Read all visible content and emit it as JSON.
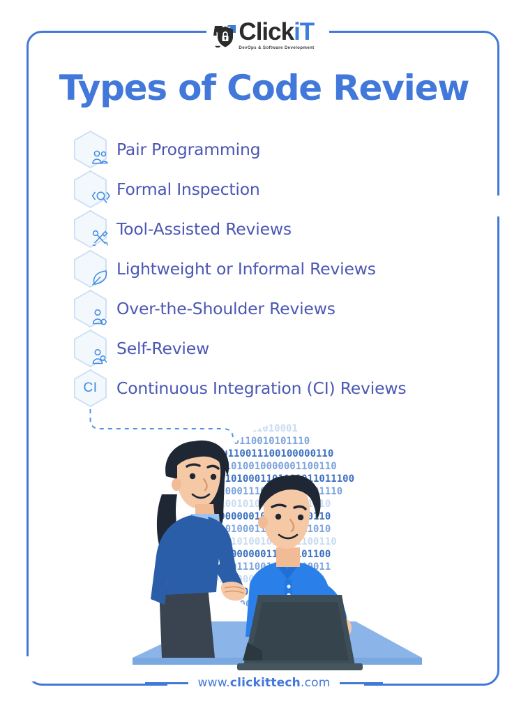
{
  "brand": {
    "logo_name": "ClickIT",
    "logo_name_plain": "Click",
    "logo_name_accent": "iT",
    "logo_tagline": "DevOps & Software Development",
    "logo_icon": "shield-lock-arrows-icon",
    "accent_color": "#4178da",
    "logo_dark_color": "#2b2b2b"
  },
  "header": {
    "title": "Types of Code Review"
  },
  "list": {
    "items": [
      {
        "label": "Pair Programming",
        "icon": "people-group-icon"
      },
      {
        "label": "Formal Inspection",
        "icon": "magnifier-brackets-icon"
      },
      {
        "label": "Tool-Assisted Reviews",
        "icon": "wrench-screwdriver-icon"
      },
      {
        "label": "Lightweight or Informal Reviews",
        "icon": "feather-pen-icon"
      },
      {
        "label": "Over-the-Shoulder Reviews",
        "icon": "person-over-shoulder-icon"
      },
      {
        "label": "Self-Review",
        "icon": "person-magnifier-icon"
      },
      {
        "label": "Continuous Integration (CI) Reviews",
        "icon": "ci-text-icon",
        "icon_text": "CI"
      }
    ],
    "text_color": "#4b57b4",
    "hex_border_color": "#cfe0f5",
    "hex_fill_color": "#f3f8fd",
    "icon_color": "#3f8ae0",
    "connector_color": "#4d93e0"
  },
  "illustration": {
    "name": "two-developers-at-laptop-illustration",
    "description": "Woman standing beside seated man working on a laptop with binary code circle background",
    "binary_rows": [
      "010000001",
      "11010001100101011",
      "011100110011100100000110",
      "00110010100100000011001100",
      "100011101000110100101101110 0",
      "100101000111001001100 0",
      "00011100101011110000111 0",
      "101110000001011110",
      "1001100100011001100110",
      "01000111010010110111001100",
      "0010111000000110101011",
      "0101000011100100110000",
      "1101011100001110",
      "101100011011110",
      "001000110011010",
      "0111011100110",
      "010110011000",
      "00000001",
      "01"
    ],
    "colors": {
      "binary_dark": "#3b6fc0",
      "binary_mid": "#7ba3dd",
      "binary_light": "#c8dbf2",
      "skin": "#f5c9a6",
      "hair": "#1e2733",
      "shirt_woman": "#2b5ea8",
      "shirt_man": "#2b7fe8",
      "laptop": "#3e4e58",
      "desk": "#8bb4e8"
    }
  },
  "footer": {
    "url_prefix": "www.",
    "url_brand": "clickittech",
    "url_suffix": ".com",
    "url_full": "www.clickittech.com",
    "rule_color": "#4178da"
  }
}
